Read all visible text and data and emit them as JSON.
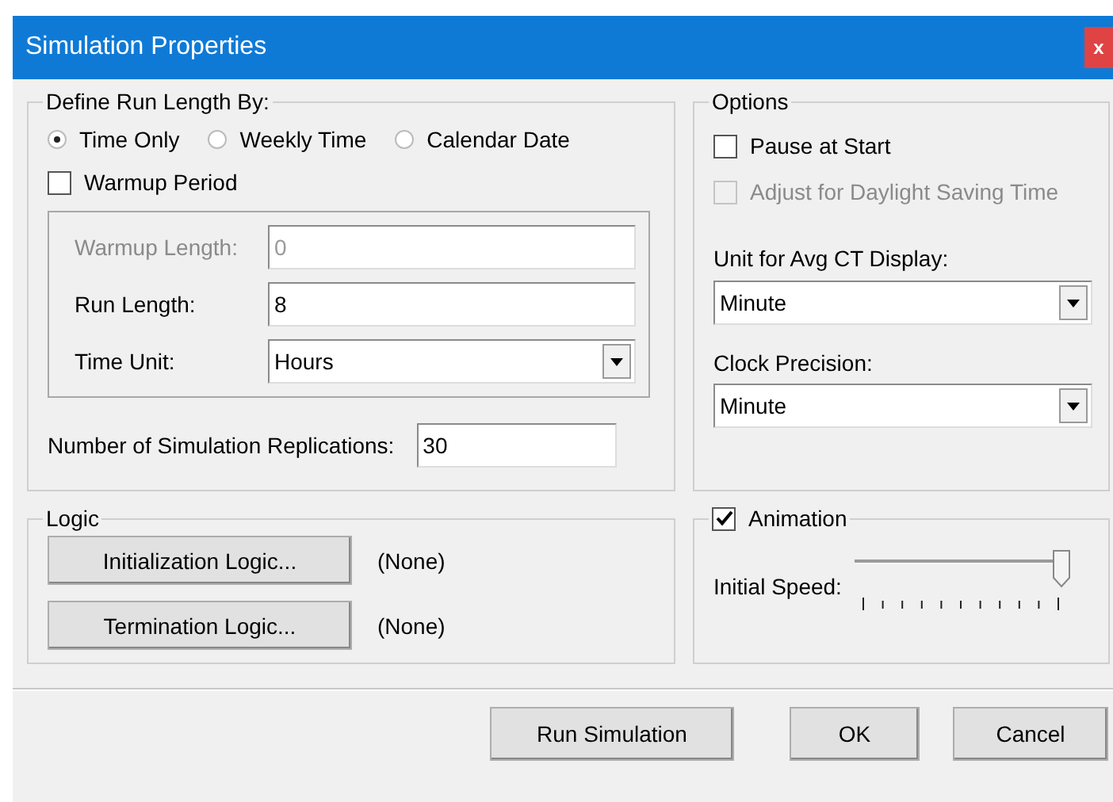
{
  "window": {
    "title": "Simulation Properties",
    "close": "x"
  },
  "run_length": {
    "title": "Define Run Length By:",
    "modes": [
      {
        "label": "Time Only",
        "selected": true
      },
      {
        "label": "Weekly Time",
        "selected": false
      },
      {
        "label": "Calendar Date",
        "selected": false
      }
    ],
    "warmup_period": {
      "label": "Warmup Period",
      "checked": false
    },
    "fields": [
      {
        "label": "Warmup Length:",
        "value": "0",
        "disabled": true,
        "kind": "text"
      },
      {
        "label": "Run Length:",
        "value": "8",
        "disabled": false,
        "kind": "text"
      },
      {
        "label": "Time Unit:",
        "value": "Hours",
        "disabled": false,
        "kind": "dropdown"
      }
    ],
    "replications": {
      "label": "Number of Simulation Replications:",
      "value": "30"
    }
  },
  "options": {
    "title": "Options",
    "checkboxes": [
      {
        "label": "Pause at Start",
        "checked": false,
        "disabled": false
      },
      {
        "label": "Adjust for Daylight Saving Time",
        "checked": false,
        "disabled": true
      }
    ],
    "dropdowns": [
      {
        "label": "Unit for Avg CT Display:",
        "value": "Minute"
      },
      {
        "label": "Clock Precision:",
        "value": "Minute"
      }
    ]
  },
  "logic": {
    "title": "Logic",
    "rows": [
      {
        "button": "Initialization Logic...",
        "value": "(None)"
      },
      {
        "button": "Termination Logic...",
        "value": "(None)"
      }
    ]
  },
  "animation": {
    "label": "Animation",
    "checked": true,
    "speed_label": "Initial Speed:",
    "level": 1
  },
  "buttons": [
    "Run Simulation",
    "OK",
    "Cancel"
  ]
}
